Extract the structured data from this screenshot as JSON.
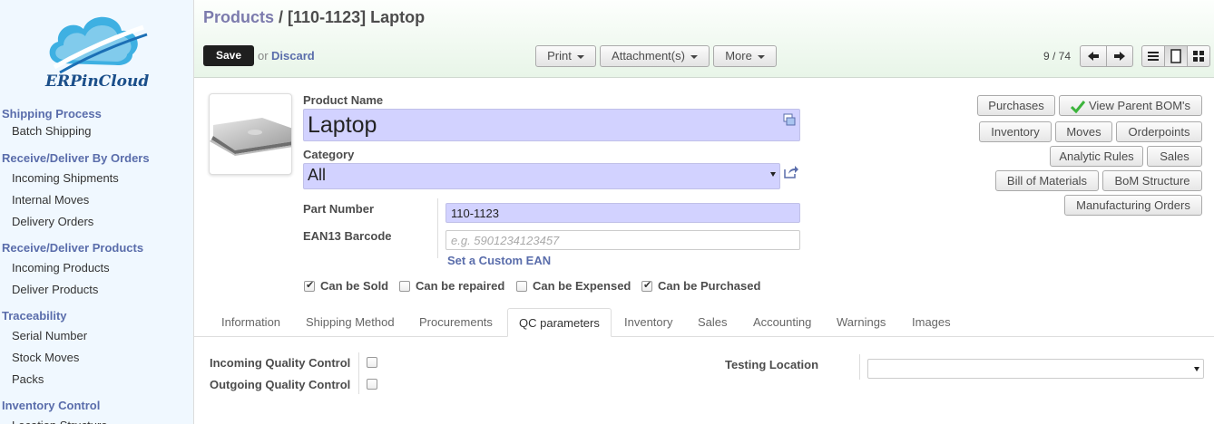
{
  "sidebar": {
    "logo_text": "ERPinCloud",
    "sections": [
      {
        "title": "Shipping Process",
        "items": [
          "Batch Shipping"
        ]
      },
      {
        "title": "Receive/Deliver By Orders",
        "items": [
          "Incoming Shipments",
          "Internal Moves",
          "Delivery Orders"
        ]
      },
      {
        "title": "Receive/Deliver Products",
        "items": [
          "Incoming Products",
          "Deliver Products"
        ]
      },
      {
        "title": "Traceability",
        "items": [
          "Serial Number",
          "Stock Moves",
          "Packs"
        ]
      },
      {
        "title": "Inventory Control",
        "items": [
          "Location Structure"
        ]
      }
    ]
  },
  "header": {
    "breadcrumb_parent": "Products",
    "breadcrumb_sep": " / ",
    "breadcrumb_current": "[110-1123] Laptop",
    "save_label": "Save",
    "or_label": "or",
    "discard_label": "Discard",
    "print_label": "Print",
    "attachments_label": "Attachment(s)",
    "more_label": "More",
    "pager": "9 / 74"
  },
  "form": {
    "product_name_label": "Product Name",
    "product_name_value": "Laptop",
    "category_label": "Category",
    "category_value": "All",
    "part_number_label": "Part Number",
    "part_number_value": "110-1123",
    "ean13_label": "EAN13 Barcode",
    "ean13_placeholder": "e.g. 5901234123457",
    "custom_ean_link": "Set a Custom EAN",
    "checkboxes": [
      {
        "label": "Can be Sold",
        "checked": true
      },
      {
        "label": "Can be repaired",
        "checked": false
      },
      {
        "label": "Can be Expensed",
        "checked": false
      },
      {
        "label": "Can be Purchased",
        "checked": true
      }
    ],
    "smart_buttons": {
      "purchases": "Purchases",
      "view_parent_bom": "View Parent BOM's",
      "inventory": "Inventory",
      "moves": "Moves",
      "orderpoints": "Orderpoints",
      "analytic_rules": "Analytic Rules",
      "sales": "Sales",
      "bill_of_materials": "Bill of Materials",
      "bom_structure": "BoM Structure",
      "manufacturing_orders": "Manufacturing Orders"
    }
  },
  "tabs": [
    "Information",
    "Shipping Method",
    "Procurements",
    "QC parameters",
    "Inventory",
    "Sales",
    "Accounting",
    "Warnings",
    "Images"
  ],
  "active_tab": "QC parameters",
  "qc": {
    "incoming_label": "Incoming Quality Control",
    "incoming_checked": false,
    "outgoing_label": "Outgoing Quality Control",
    "outgoing_checked": false,
    "testing_location_label": "Testing Location",
    "testing_location_value": ""
  },
  "colors": {
    "required_field": "#d2d2ff",
    "link": "#5a6dab",
    "sidebar_bg": "#f0f8ff",
    "header_bg": "#e8f5e8"
  }
}
